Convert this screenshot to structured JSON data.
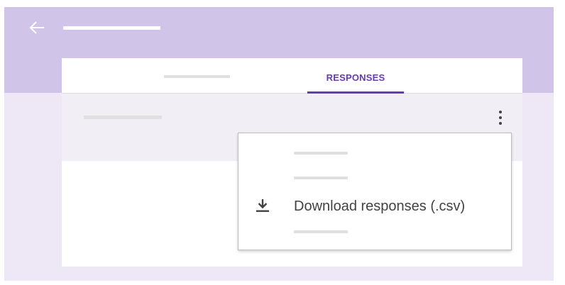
{
  "header": {
    "back_icon": "arrow-back-icon",
    "colors": {
      "header_bg": "#d1c4e9",
      "accent": "#673ab7"
    }
  },
  "tabs": {
    "active_label": "RESPONSES"
  },
  "menu": {
    "items": [
      {
        "label": "Download responses (.csv)",
        "icon": "download-icon"
      }
    ]
  },
  "row": {
    "more_icon": "more-vert-icon"
  }
}
